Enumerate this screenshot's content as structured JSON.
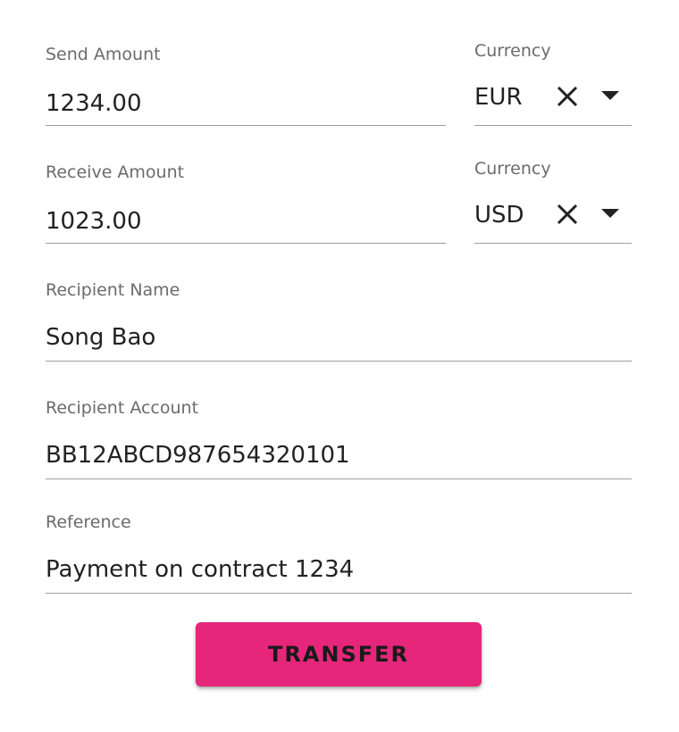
{
  "form": {
    "send_amount": {
      "label": "Send Amount",
      "value": "1234.00"
    },
    "send_currency": {
      "label": "Currency",
      "value": "EUR",
      "clear_icon": "close-icon",
      "dropdown_icon": "arrow-drop-down-icon"
    },
    "receive_amount": {
      "label": "Receive Amount",
      "value": "1023.00"
    },
    "receive_currency": {
      "label": "Currency",
      "value": "USD",
      "clear_icon": "close-icon",
      "dropdown_icon": "arrow-drop-down-icon"
    },
    "recipient_name": {
      "label": "Recipient Name",
      "value": "Song Bao"
    },
    "recipient_account": {
      "label": "Recipient Account",
      "value": "BB12ABCD987654320101"
    },
    "reference": {
      "label": "Reference",
      "value": "Payment on contract 1234"
    }
  },
  "actions": {
    "transfer_label": "TRANSFER"
  },
  "colors": {
    "accent": "#e6267a",
    "underline": "#9e9e9e",
    "label": "#6b6b6b",
    "text": "#222222"
  }
}
